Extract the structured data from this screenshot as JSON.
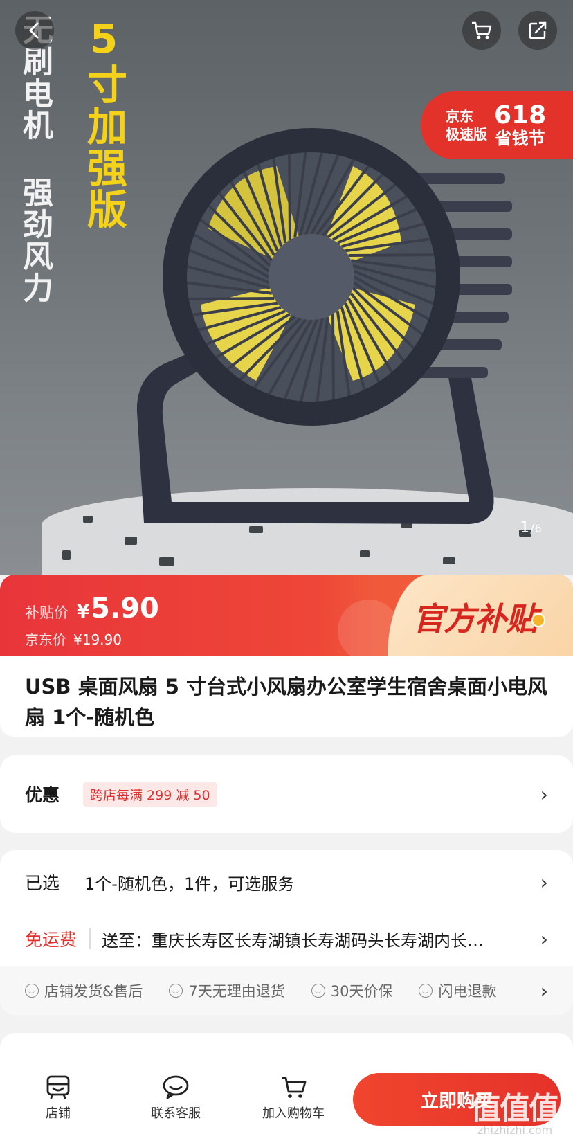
{
  "hero": {
    "vertical_text_white_1": "无刷电机",
    "vertical_text_white_2": "强劲风力",
    "vertical_text_yellow": "5寸加强版",
    "promo_badge": {
      "left_line1": "京东",
      "left_line2": "极速版",
      "right_big": "618",
      "right_sub": "省钱节"
    },
    "page_indicator": {
      "current": "1",
      "sep": "/",
      "total": "6"
    }
  },
  "price": {
    "subsidy_label": "补贴价",
    "currency": "¥",
    "subsidy_price": "5.90",
    "jd_label": "京东价",
    "jd_price": "¥19.90",
    "official_tag": "官方补贴"
  },
  "product": {
    "title": "USB 桌面风扇 5 寸台式小风扇办公室学生宿舍桌面小电风扇 1个-随机色"
  },
  "discount": {
    "label": "优惠",
    "coupon": "跨店每满 299 减 50",
    "chevron": "›"
  },
  "spec": {
    "selected_label": "已选",
    "selected_value": "1个-随机色，1件，可选服务",
    "shipping_label": "免运费",
    "address": "送至：重庆长寿区长寿湖镇长寿湖码头长寿湖内长…",
    "chevron": "›"
  },
  "services": [
    {
      "icon": "smile-icon",
      "label": "店铺发货&售后"
    },
    {
      "icon": "smile-icon",
      "label": "7天无理由退货"
    },
    {
      "icon": "smile-icon",
      "label": "30天价保"
    },
    {
      "icon": "smile-icon",
      "label": "闪电退款"
    }
  ],
  "bottom_bar": {
    "store": "店铺",
    "customer_service": "联系客服",
    "add_to_cart": "加入购物车",
    "buy_now": "立即购买"
  },
  "watermark": {
    "main": "值值值",
    "sub": "zhizhizhi.com"
  },
  "colors": {
    "accent_red": "#e5322a",
    "subsidy_yellow": "#f5d21a",
    "coupon_bg": "#fde8e8"
  }
}
